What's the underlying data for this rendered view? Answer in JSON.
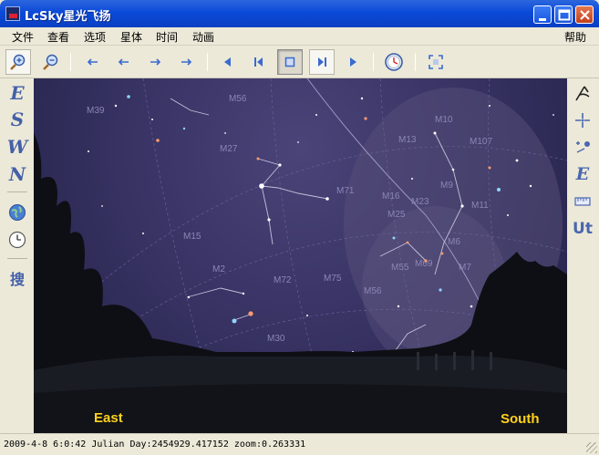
{
  "window": {
    "title": "LcSky星光飞扬",
    "controls": [
      "minimize-icon",
      "maximize-icon",
      "close-icon"
    ]
  },
  "menu": {
    "items": [
      "文件",
      "查看",
      "选项",
      "星体",
      "时间",
      "动画"
    ],
    "help": "帮助"
  },
  "toolbar": {
    "buttons": [
      {
        "name": "zoom-in-icon",
        "state": "boxed"
      },
      {
        "name": "zoom-out-icon"
      },
      {
        "name": "arrow-left-far-icon"
      },
      {
        "name": "arrow-left-icon"
      },
      {
        "name": "arrow-right-icon"
      },
      {
        "name": "arrow-right-far-icon"
      },
      {
        "name": "play-backward-icon"
      },
      {
        "name": "step-backward-icon"
      },
      {
        "name": "stop-icon",
        "state": "pressed"
      },
      {
        "name": "step-forward-icon",
        "state": "boxed"
      },
      {
        "name": "play-forward-icon"
      },
      {
        "name": "clock-reset-icon"
      },
      {
        "name": "fullscreen-icon"
      }
    ]
  },
  "left_tools": {
    "letters": [
      "E",
      "S",
      "W",
      "N"
    ],
    "search_label": "搜"
  },
  "right_tools": {
    "ecliptic_label": "E",
    "ut_label": "Ut"
  },
  "sky": {
    "east_label": "East",
    "south_label": "South",
    "colors": {
      "sky": "#3a3566",
      "horizon_text": "#ffd21a",
      "constellation": "#d8d8ee"
    }
  },
  "status": {
    "text": "2009-4-8 6:0:42 Julian Day:2454929.417152 zoom:0.263331"
  }
}
